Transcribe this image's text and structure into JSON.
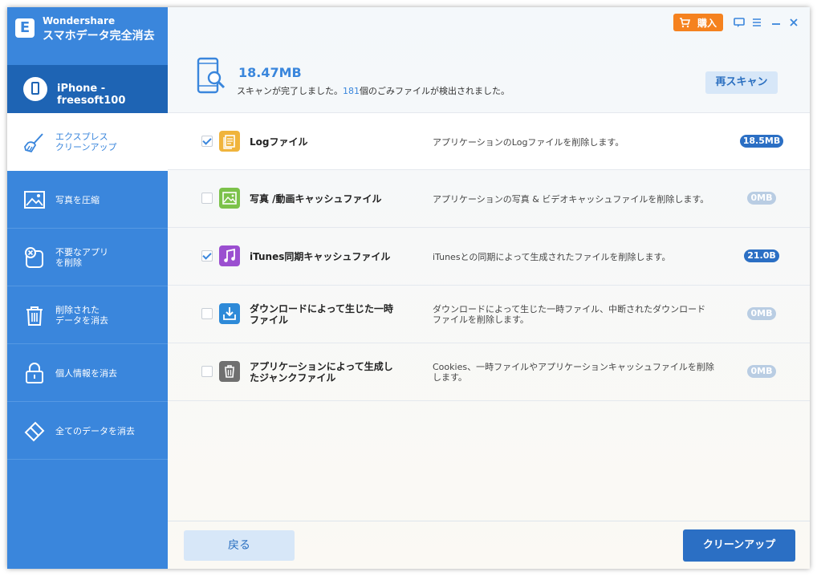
{
  "app": {
    "brand_line1": "Wondershare",
    "brand_line2": "スマホデータ完全消去",
    "logo_letter": "E"
  },
  "device": {
    "label": "iPhone - freesoft100",
    "icon": "phone-icon"
  },
  "sidebar": {
    "items": [
      {
        "label": "エクスプレス\nクリーンアップ",
        "icon": "broom-icon",
        "active": true
      },
      {
        "label": "写真を圧縮",
        "icon": "image-icon",
        "active": false
      },
      {
        "label": "不要なアプリ\nを削除",
        "icon": "app-remove-icon",
        "active": false
      },
      {
        "label": "削除された\nデータを消去",
        "icon": "trash-icon",
        "active": false
      },
      {
        "label": "個人情報を消去",
        "icon": "lock-icon",
        "active": false
      },
      {
        "label": "全てのデータを消去",
        "icon": "eraser-icon",
        "active": false
      }
    ]
  },
  "topbar": {
    "buy_label": "購入",
    "icons": [
      "cart-icon",
      "feedback-icon",
      "menu-icon",
      "minimize-icon",
      "close-icon"
    ]
  },
  "summary": {
    "size": "18.47MB",
    "msg_prefix": "スキャンが完了しました。",
    "count": "181",
    "msg_suffix": "個のごみファイルが検出されました。",
    "rescan_label": "再スキャン"
  },
  "categories": [
    {
      "name": "Logファイル",
      "desc": "アプリケーションのLogファイルを削除します。",
      "size": "18.5MB",
      "checked": true,
      "icon": "log-file-icon",
      "icon_color": "#f0b43c"
    },
    {
      "name": "写真 /動画キャッシュファイル",
      "desc": "アプリケーションの写真 & ビデオキャッシュファイルを削除します。",
      "size": "0MB",
      "checked": false,
      "icon": "photo-cache-icon",
      "icon_color": "#7cc24a"
    },
    {
      "name": "iTunes同期キャッシュファイル",
      "desc": "iTunesとの同期によって生成されたファイルを削除します。",
      "size": "21.0B",
      "checked": true,
      "icon": "music-note-icon",
      "icon_color": "#9b4fd0"
    },
    {
      "name": "ダウンロードによって生じた一時ファイル",
      "desc": "ダウンロードによって生じた一時ファイル、中断されたダウンロードファイルを削除します。",
      "size": "0MB",
      "checked": false,
      "icon": "download-icon",
      "icon_color": "#2e8ad8"
    },
    {
      "name": "アプリケーションによって生成したジャンクファイル",
      "desc": "Cookies、一時ファイルやアプリケーションキャッシュファイルを削除します。",
      "size": "0MB",
      "checked": false,
      "icon": "junk-trash-icon",
      "icon_color": "#707070"
    }
  ],
  "footer": {
    "back_label": "戻る",
    "clean_label": "クリーンアップ"
  },
  "colors": {
    "accent": "#3a86dc",
    "dark_accent": "#1e64b4",
    "buy": "#f5821f",
    "badge_active": "#2b6fc4",
    "badge_zero": "#b9cde3"
  }
}
